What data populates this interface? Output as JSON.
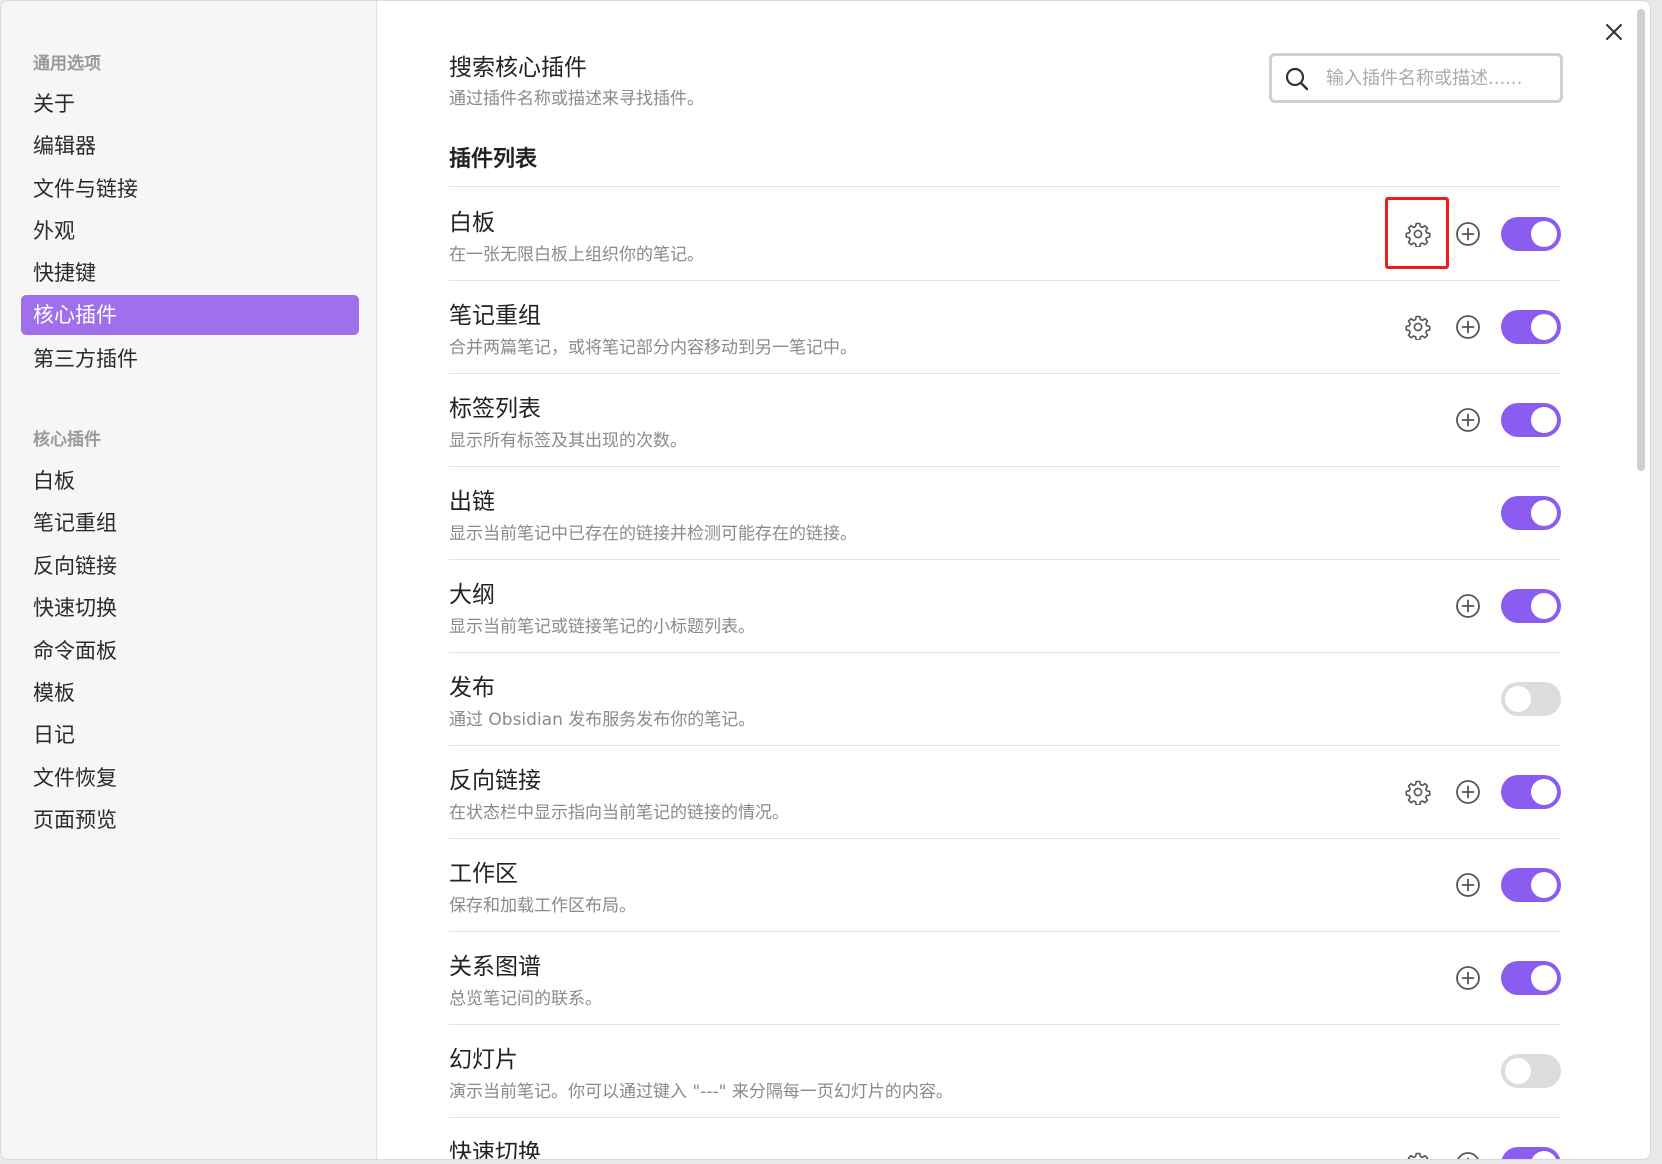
{
  "sidebar": {
    "general_heading": "通用选项",
    "general_items": [
      {
        "label": "关于"
      },
      {
        "label": "编辑器"
      },
      {
        "label": "文件与链接"
      },
      {
        "label": "外观"
      },
      {
        "label": "快捷键"
      },
      {
        "label": "核心插件",
        "active": true
      },
      {
        "label": "第三方插件"
      }
    ],
    "core_heading": "核心插件",
    "core_items": [
      {
        "label": "白板"
      },
      {
        "label": "笔记重组"
      },
      {
        "label": "反向链接"
      },
      {
        "label": "快速切换"
      },
      {
        "label": "命令面板"
      },
      {
        "label": "模板"
      },
      {
        "label": "日记"
      },
      {
        "label": "文件恢复"
      },
      {
        "label": "页面预览"
      }
    ]
  },
  "search": {
    "title": "搜索核心插件",
    "description": "通过插件名称或描述来寻找插件。",
    "placeholder": "输入插件名称或描述......"
  },
  "plugin_list": {
    "title": "插件列表",
    "plugins": [
      {
        "name": "白板",
        "description": "在一张无限白板上组织你的笔记。",
        "has_settings": true,
        "has_hotkey": true,
        "enabled": true,
        "highlighted": true
      },
      {
        "name": "笔记重组",
        "description": "合并两篇笔记，或将笔记部分内容移动到另一笔记中。",
        "has_settings": true,
        "has_hotkey": true,
        "enabled": true
      },
      {
        "name": "标签列表",
        "description": "显示所有标签及其出现的次数。",
        "has_settings": false,
        "has_hotkey": true,
        "enabled": true
      },
      {
        "name": "出链",
        "description": "显示当前笔记中已存在的链接并检测可能存在的链接。",
        "has_settings": false,
        "has_hotkey": false,
        "enabled": true
      },
      {
        "name": "大纲",
        "description": "显示当前笔记或链接笔记的小标题列表。",
        "has_settings": false,
        "has_hotkey": true,
        "enabled": true
      },
      {
        "name": "发布",
        "description": "通过 Obsidian 发布服务发布你的笔记。",
        "has_settings": false,
        "has_hotkey": false,
        "enabled": false
      },
      {
        "name": "反向链接",
        "description": "在状态栏中显示指向当前笔记的链接的情况。",
        "has_settings": true,
        "has_hotkey": true,
        "enabled": true
      },
      {
        "name": "工作区",
        "description": "保存和加载工作区布局。",
        "has_settings": false,
        "has_hotkey": true,
        "enabled": true
      },
      {
        "name": "关系图谱",
        "description": "总览笔记间的联系。",
        "has_settings": false,
        "has_hotkey": true,
        "enabled": true
      },
      {
        "name": "幻灯片",
        "description": "演示当前笔记。你可以通过键入 \"---\" 来分隔每一页幻灯片的内容。",
        "has_settings": false,
        "has_hotkey": false,
        "enabled": false
      },
      {
        "name": "快速切换",
        "description": "",
        "has_settings": true,
        "has_hotkey": true,
        "enabled": true
      }
    ]
  },
  "colors": {
    "accent": "#8b5cf0",
    "sidebar_active": "#a070ec",
    "highlight_box": "#ee1c1c"
  }
}
